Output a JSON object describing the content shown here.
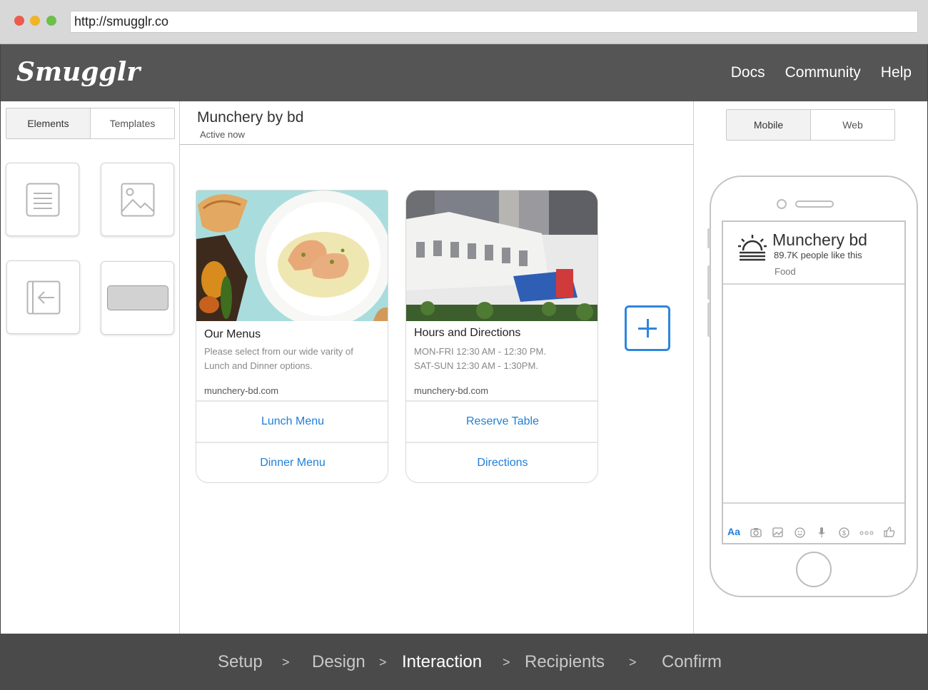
{
  "browser": {
    "url": "http://smugglr.co"
  },
  "app": {
    "logo": "Smugglr",
    "nav": [
      "Docs",
      "Community",
      "Help"
    ]
  },
  "left_panel": {
    "tabs": [
      "Elements",
      "Templates"
    ],
    "active_tab": "Elements",
    "elements": [
      "text-icon",
      "image-icon",
      "back-arrow-icon",
      "button-shape"
    ]
  },
  "center": {
    "title": "Munchery by bd",
    "status": "Active now",
    "cards": [
      {
        "image": "food-photo",
        "title": "Our Menus",
        "description": "Please select from our wide varity of Lunch and Dinner options.",
        "url": "munchery-bd.com",
        "actions": [
          "Lunch Menu",
          "Dinner Menu"
        ]
      },
      {
        "image": "building-photo",
        "title": "Hours and Directions",
        "line1": "MON-FRI 12:30 AM - 12:30 PM.",
        "line2": "SAT-SUN 12:30 AM - 1:30PM.",
        "url": "munchery-bd.com",
        "actions": [
          "Reserve Table",
          "Directions"
        ]
      }
    ]
  },
  "right_panel": {
    "tabs": [
      "Mobile",
      "Web"
    ],
    "active_tab": "Mobile",
    "preview": {
      "name": "Munchery bd",
      "likes": "89.7K people like this",
      "category": "Food",
      "composer": {
        "text_label": "Aa",
        "icons": [
          "camera-icon",
          "gallery-icon",
          "emoji-icon",
          "mic-icon",
          "payment-icon",
          "more-icon",
          "like-icon"
        ]
      }
    }
  },
  "steps": {
    "items": [
      "Setup",
      "Design",
      "Interaction",
      "Recipients",
      "Confirm"
    ],
    "separator": ">",
    "active": "Interaction"
  },
  "colors": {
    "accent": "#1f7fd8",
    "header_bg": "#555555",
    "footer_bg": "#4a4a4a"
  }
}
